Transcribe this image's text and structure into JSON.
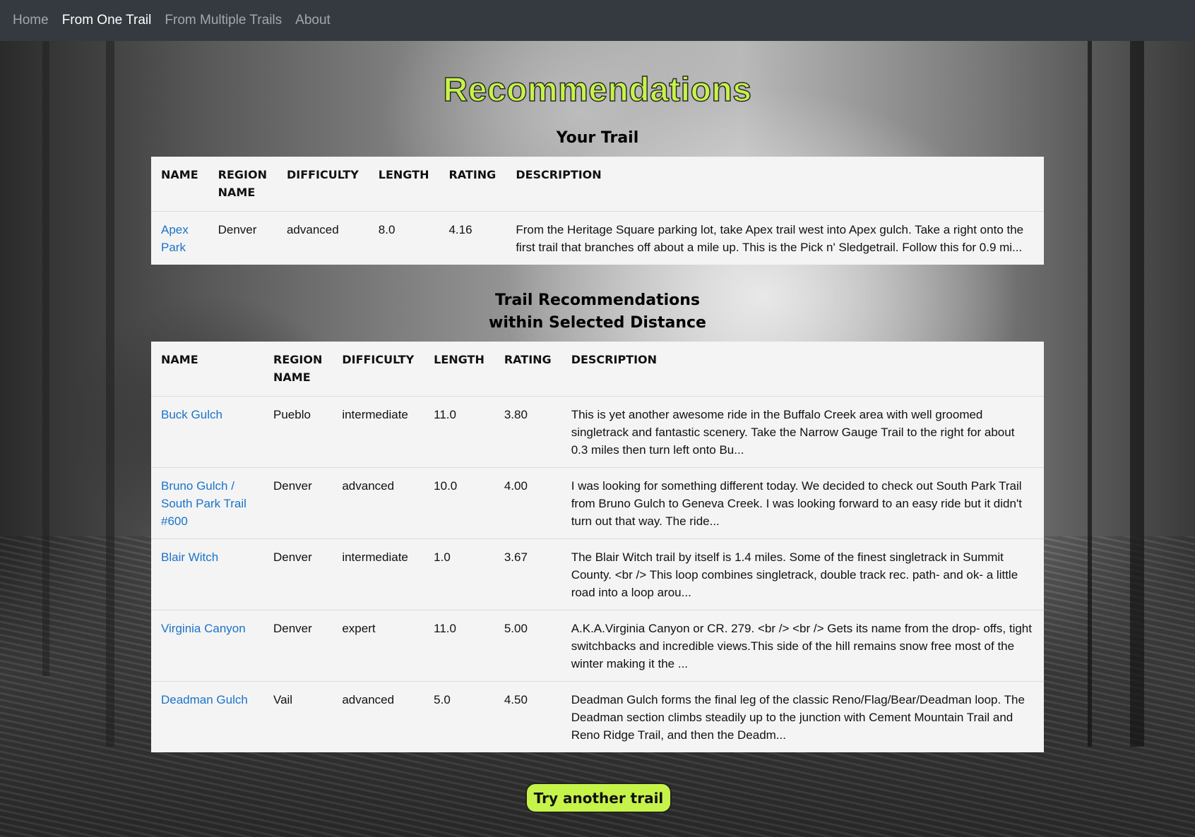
{
  "nav": {
    "items": [
      {
        "label": "Home",
        "active": false
      },
      {
        "label": "From One Trail",
        "active": true
      },
      {
        "label": "From Multiple Trails",
        "active": false
      },
      {
        "label": "About",
        "active": false
      }
    ]
  },
  "colors": {
    "accent": "#c6f34a",
    "navbar": "#343a40",
    "link": "#1a73c9"
  },
  "page_title": "Recommendations",
  "your_trail": {
    "heading": "Your Trail",
    "columns": [
      "NAME",
      "REGION NAME",
      "DIFFICULTY",
      "LENGTH",
      "RATING",
      "DESCRIPTION"
    ],
    "rows": [
      {
        "name": "Apex Park",
        "region": "Denver",
        "difficulty": "advanced",
        "length": "8.0",
        "rating": "4.16",
        "description": "From the Heritage Square parking lot, take Apex trail west into Apex gulch. Take a right onto the first trail that branches off about a mile up. This is the Pick n' Sledgetrail. Follow this for 0.9 mi..."
      }
    ]
  },
  "recommendations": {
    "heading_line1": "Trail Recommendations",
    "heading_line2": "within Selected Distance",
    "columns": [
      "NAME",
      "REGION NAME",
      "DIFFICULTY",
      "LENGTH",
      "RATING",
      "DESCRIPTION"
    ],
    "rows": [
      {
        "name": "Buck Gulch",
        "region": "Pueblo",
        "difficulty": "intermediate",
        "length": "11.0",
        "rating": "3.80",
        "description": "This is yet another awesome ride in the Buffalo Creek area with well groomed singletrack and fantastic scenery. Take the Narrow Gauge Trail to the right for about 0.3 miles then turn left onto Bu..."
      },
      {
        "name": "Bruno Gulch / South Park Trail #600",
        "region": "Denver",
        "difficulty": "advanced",
        "length": "10.0",
        "rating": "4.00",
        "description": "I was looking for something different today. We decided to check out South Park Trail from Bruno Gulch to Geneva Creek. I was looking forward to an easy ride but it didn't turn out that way. The ride..."
      },
      {
        "name": "Blair Witch",
        "region": "Denver",
        "difficulty": "intermediate",
        "length": "1.0",
        "rating": "3.67",
        "description": "The Blair Witch trail by itself is 1.4 miles. Some of the finest singletrack in Summit County. <br /> This loop combines singletrack, double track rec. path- and ok- a little road into a loop arou..."
      },
      {
        "name": "Virginia Canyon",
        "region": "Denver",
        "difficulty": "expert",
        "length": "11.0",
        "rating": "5.00",
        "description": "A.K.A.Virginia Canyon or CR. 279. <br /> <br /> Gets its name from the drop- offs, tight switchbacks and incredible views.This side of the hill remains snow free most of the winter making it the ..."
      },
      {
        "name": "Deadman Gulch",
        "region": "Vail",
        "difficulty": "advanced",
        "length": "5.0",
        "rating": "4.50",
        "description": "Deadman Gulch forms the final leg of the classic Reno/Flag/Bear/Deadman loop. The Deadman section climbs steadily up to the junction with Cement Mountain Trail and Reno Ridge Trail, and then the Deadm..."
      }
    ]
  },
  "try_button": "Try another trail"
}
